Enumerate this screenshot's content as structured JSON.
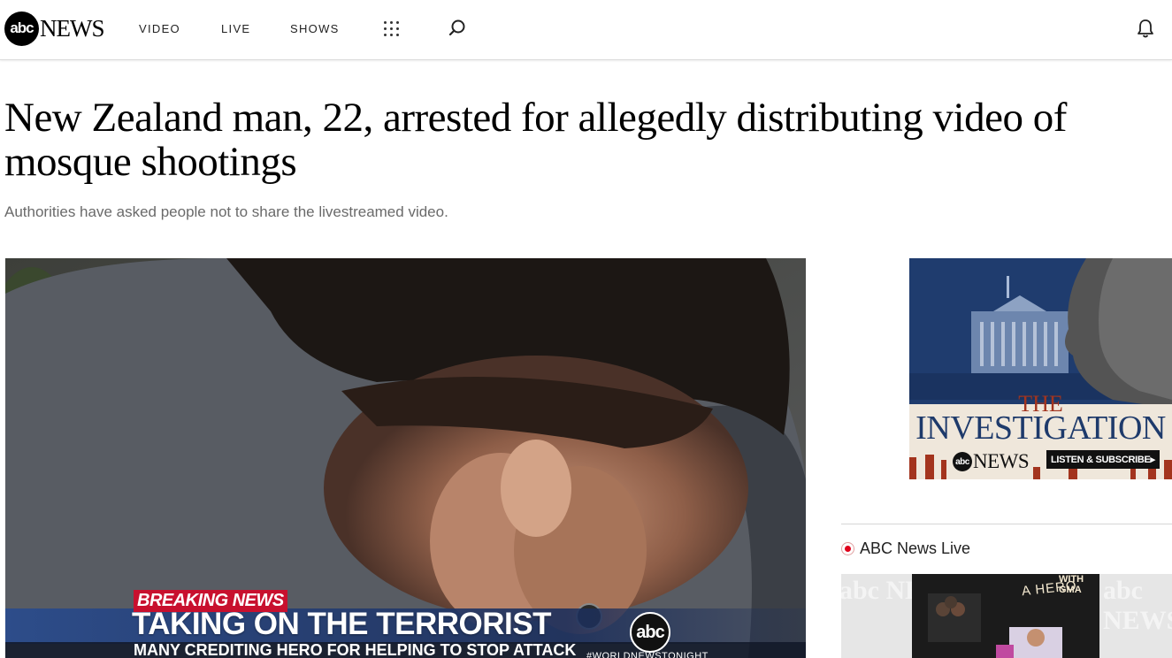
{
  "header": {
    "logo_mark": "abc",
    "logo_text": "NEWS",
    "nav": [
      {
        "label": "VIDEO"
      },
      {
        "label": "LIVE"
      },
      {
        "label": "SHOWS"
      }
    ],
    "icons": [
      "grid-menu-icon",
      "search-icon",
      "bell-icon"
    ]
  },
  "article": {
    "headline": "New Zealand man, 22, arrested for allegedly distributing video of mosque shootings",
    "subhead": "Authorities have asked people not to share the livestreamed video."
  },
  "hero_video": {
    "breaking": "BREAKING NEWS",
    "title": "TAKING ON THE TERRORIST",
    "subtitle": "MANY CREDITING HERO FOR HELPING TO STOP ATTACK",
    "bug": "abc",
    "hashtag": "#WORLDNEWSTONIGHT"
  },
  "podcast_ad": {
    "the": "THE",
    "title": "INVESTIGATION",
    "logo_mark": "abc",
    "logo_text": "NEWS",
    "cta": "LISTEN & SUBSCRIBE▸",
    "colors": {
      "navy": "#1e3a6b",
      "rust": "#a3341e",
      "cream": "#efe7db"
    }
  },
  "live": {
    "label": "ABC News Live",
    "thumb_text": "A HERO",
    "thumb_badge": "WITH GMA",
    "watermark": "abc NEWS"
  }
}
